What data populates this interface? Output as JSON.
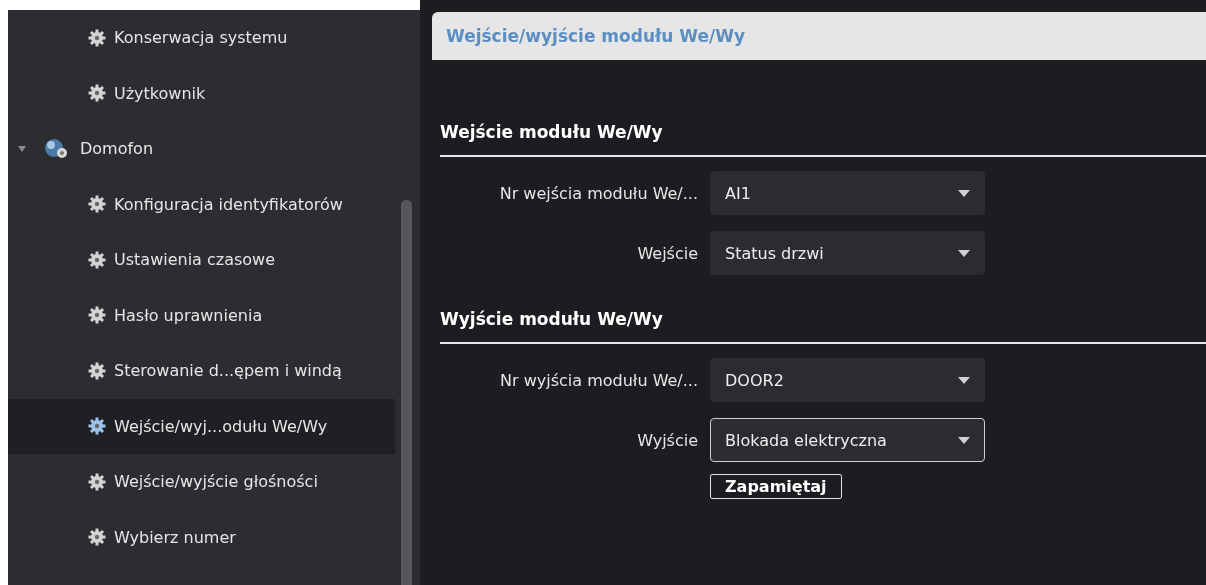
{
  "sidebar": {
    "items": [
      {
        "label": "Konserwacja systemu",
        "selected": false
      },
      {
        "label": "Użytkownik",
        "selected": false
      },
      {
        "label": "Domofon",
        "expanded": true,
        "selected": false,
        "children": [
          {
            "label": "Konfiguracja identyfikatorów",
            "selected": false
          },
          {
            "label": "Ustawienia czasowe",
            "selected": false
          },
          {
            "label": "Hasło uprawnienia",
            "selected": false
          },
          {
            "label": "Sterowanie d...ępem i windą",
            "selected": false
          },
          {
            "label": "Wejście/wyj...odułu We/Wy",
            "selected": true
          },
          {
            "label": "Wejście/wyjście głośności",
            "selected": false
          },
          {
            "label": "Wybierz numer",
            "selected": false
          }
        ]
      }
    ]
  },
  "page": {
    "title": "Wejście/wyjście modułu We/Wy",
    "sections": [
      {
        "heading": "Wejście modułu We/Wy",
        "fields": [
          {
            "label": "Nr wejścia modułu We/...",
            "value": "AI1",
            "focused": false
          },
          {
            "label": "Wejście",
            "value": "Status drzwi",
            "focused": false
          }
        ]
      },
      {
        "heading": "Wyjście modułu We/Wy",
        "fields": [
          {
            "label": "Nr wyjścia modułu We/...",
            "value": "DOOR2",
            "focused": false
          },
          {
            "label": "Wyjście",
            "value": "Blokada elektryczna",
            "focused": true
          }
        ]
      }
    ],
    "save_button": "Zapamiętaj"
  }
}
